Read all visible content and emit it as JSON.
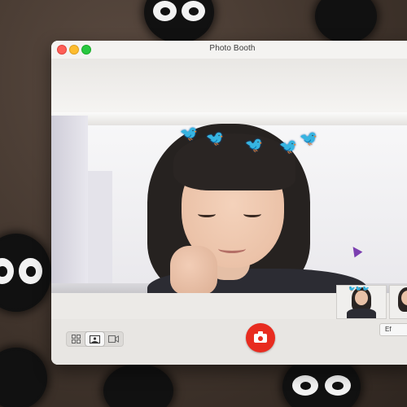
{
  "window": {
    "title": "Photo Booth"
  },
  "toolbar": {
    "modes": [
      {
        "name": "four-up",
        "icon": "grid-icon"
      },
      {
        "name": "single",
        "icon": "photo-icon",
        "active": true
      },
      {
        "name": "video",
        "icon": "video-camera-icon"
      }
    ],
    "shutter_icon": "camera-icon",
    "effects_label": "Ef"
  },
  "preview": {
    "effect_icon": "bird-crown"
  },
  "colors": {
    "shutter": "#e82c20",
    "birds": "#2d8fe0"
  }
}
